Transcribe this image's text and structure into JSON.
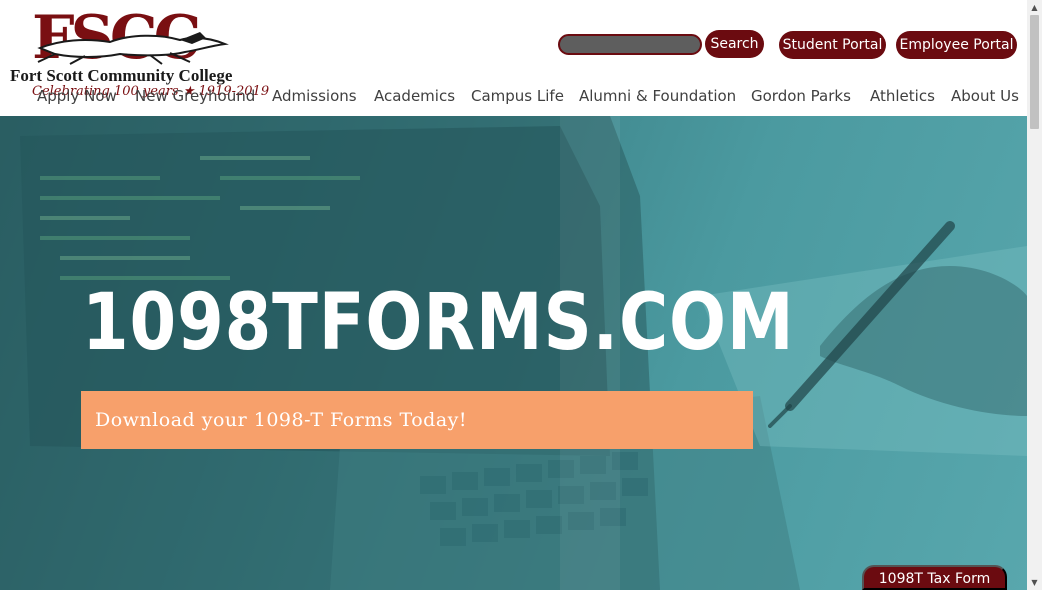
{
  "header": {
    "logo": {
      "letters": "FSCC",
      "name": "Fort Scott Community College",
      "tagline": "Celebrating 100 years ★ 1919-2019"
    },
    "search": {
      "placeholder": "",
      "button_label": "Search"
    },
    "student_portal_label": "Student Portal",
    "employee_portal_label": "Employee Portal"
  },
  "nav": {
    "items": [
      {
        "label": "Apply Now"
      },
      {
        "label": "New Greyhound"
      },
      {
        "label": "Admissions"
      },
      {
        "label": "Academics"
      },
      {
        "label": "Campus Life"
      },
      {
        "label": "Alumni & Foundation"
      },
      {
        "label": "Gordon Parks"
      },
      {
        "label": "Athletics"
      },
      {
        "label": "About Us"
      }
    ]
  },
  "hero": {
    "title": "1098TFORMS.COM",
    "banner_text": "Download your 1098-T Forms Today!"
  },
  "floating_button_label": "1098T Tax Form",
  "colors": {
    "brand_maroon": "#6b0b10",
    "banner_orange": "#f7a06b",
    "hero_teal": "#3a7e84"
  },
  "icons": {
    "scroll_up": "▲",
    "scroll_down": "▼"
  }
}
